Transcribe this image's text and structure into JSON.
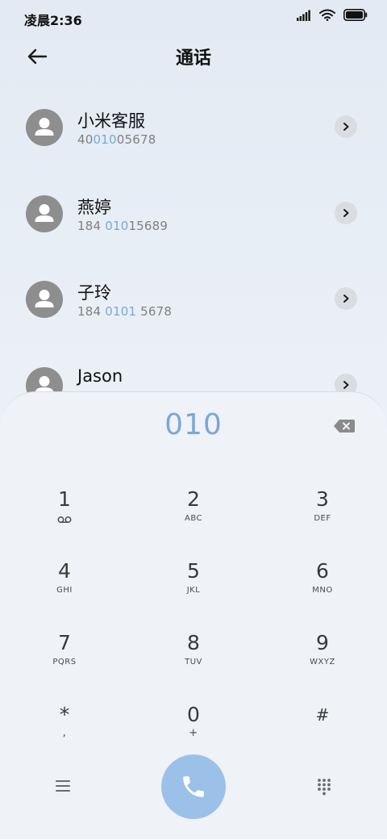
{
  "status_bar": {
    "time": "凌晨2:36",
    "icons": [
      "signal-icon",
      "wifi-icon",
      "battery-icon"
    ]
  },
  "header": {
    "title": "通话",
    "back_icon": "arrow-left-icon"
  },
  "contacts": [
    {
      "name": "小米客服",
      "number_parts": [
        "40",
        "010",
        "05678"
      ]
    },
    {
      "name": "燕婷",
      "number_parts": [
        "184 ",
        "010",
        "15689"
      ]
    },
    {
      "name": "子玲",
      "number_parts": [
        "184 ",
        "0101",
        " 5678"
      ]
    },
    {
      "name": "Jason",
      "number_parts": [
        "",
        "",
        ""
      ]
    }
  ],
  "dialer": {
    "input": "010",
    "keys": [
      {
        "digit": "1",
        "letters": ""
      },
      {
        "digit": "2",
        "letters": "ABC"
      },
      {
        "digit": "3",
        "letters": "DEF"
      },
      {
        "digit": "4",
        "letters": "GHI"
      },
      {
        "digit": "5",
        "letters": "JKL"
      },
      {
        "digit": "6",
        "letters": "MNO"
      },
      {
        "digit": "7",
        "letters": "PQRS"
      },
      {
        "digit": "8",
        "letters": "TUV"
      },
      {
        "digit": "9",
        "letters": "WXYZ"
      },
      {
        "digit": "*",
        "letters": ","
      },
      {
        "digit": "0",
        "letters": "+"
      },
      {
        "digit": "#",
        "letters": ""
      }
    ]
  },
  "colors": {
    "accent": "#7aa8d6",
    "call_button": "#9cc1e8",
    "avatar": "#8e8e8e"
  }
}
